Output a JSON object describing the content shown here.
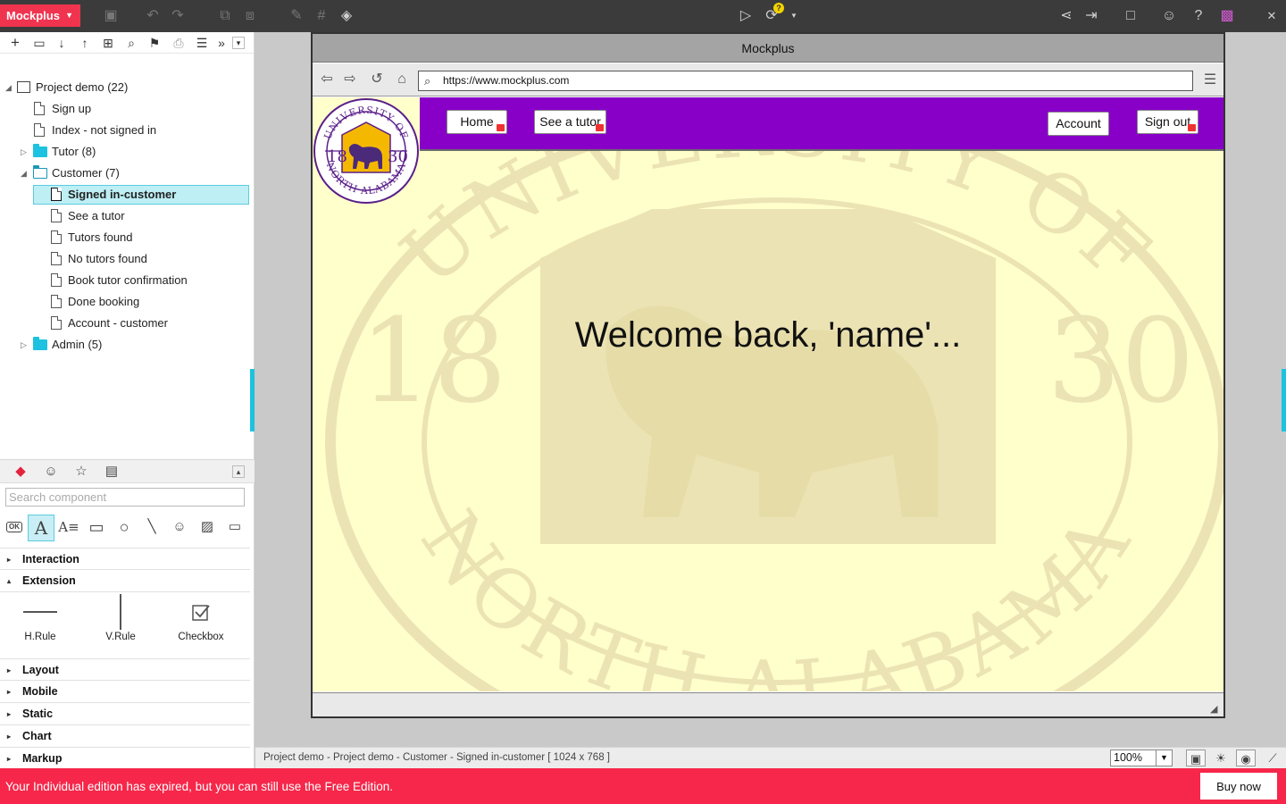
{
  "app": {
    "menu_label": "Mockplus",
    "toolbar_icons": [
      "save-icon",
      "undo-icon",
      "redo-icon",
      "group-icon",
      "ungroup-icon",
      "format-brush-icon",
      "grid-icon",
      "fill-icon",
      "play-icon",
      "sync-icon",
      "share-icon",
      "export-icon",
      "fullscreen-icon",
      "users-icon",
      "help-icon",
      "qr-code-icon",
      "close-icon"
    ],
    "sync_badge": "?"
  },
  "tree_toolbar_icons": [
    "add-icon",
    "folder-icon",
    "move-down-icon",
    "move-up-icon",
    "hierarchy-icon",
    "search-icon",
    "flag-icon",
    "print-icon",
    "list-icon",
    "more-icon",
    "collapse-icon"
  ],
  "tree": {
    "project": "Project demo (22)",
    "items": [
      {
        "label": "Sign up"
      },
      {
        "label": "Index - not signed in"
      },
      {
        "label": "Tutor (8)"
      },
      {
        "label": "Customer (7)"
      },
      {
        "label": "Signed in-customer"
      },
      {
        "label": "See a tutor"
      },
      {
        "label": "Tutors found"
      },
      {
        "label": "No tutors found"
      },
      {
        "label": "Book tutor confirmation"
      },
      {
        "label": "Done booking"
      },
      {
        "label": "Account - customer"
      },
      {
        "label": "Admin (5)"
      }
    ]
  },
  "components": {
    "search_placeholder": "Search component",
    "categories": {
      "interaction": "Interaction",
      "extension": "Extension",
      "layout": "Layout",
      "mobile": "Mobile",
      "static": "Static",
      "chart": "Chart",
      "markup": "Markup"
    },
    "extension_items": [
      "H.Rule",
      "V.Rule",
      "Checkbox"
    ]
  },
  "browser": {
    "title": "Mockplus",
    "url": "https://www.mockplus.com"
  },
  "page": {
    "nav": {
      "home": "Home",
      "see_tutor": "See a tutor",
      "account": "Account",
      "sign_out": "Sign out"
    },
    "welcome": "Welcome back, 'name'...",
    "seal": {
      "top_text": "UNIVERSITY OF",
      "bottom_text": "NORTH ALABAMA",
      "year_left": "18",
      "year_right": "30"
    },
    "colors": {
      "nav_bg": "#8800c8",
      "page_bg": "#ffffcc",
      "seal_gold": "#f5b800"
    }
  },
  "statusbar": {
    "path": "Project demo - Project demo - Customer - Signed in-customer [ 1024 x 768 ]",
    "zoom": "100%"
  },
  "banner": {
    "message": "Your Individual edition has expired, but you can still use the Free Edition.",
    "buy_label": "Buy now"
  }
}
